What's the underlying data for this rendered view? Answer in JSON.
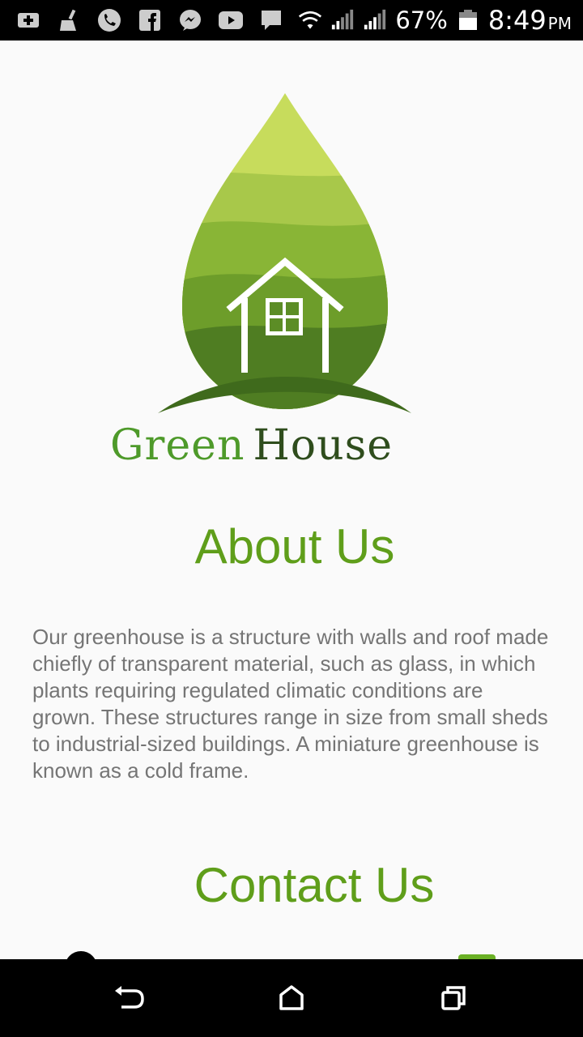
{
  "status_bar": {
    "battery_percent": "67%",
    "time": "8:49",
    "ampm": "PM",
    "icons": [
      "add-box-icon",
      "broom-icon",
      "phone-icon",
      "facebook-icon",
      "messenger-icon",
      "youtube-icon",
      "message-icon",
      "wifi-icon",
      "signal-1-icon",
      "signal-2-icon",
      "battery-icon"
    ]
  },
  "logo": {
    "brand_green": "Green",
    "brand_house": "House"
  },
  "about": {
    "title": "About Us",
    "text": "Our greenhouse is a structure with walls and roof made chiefly of transparent material, such as glass, in which plants requiring regulated climatic conditions are grown. These structures range in size from small sheds to industrial-sized buildings. A miniature greenhouse is known as a cold frame."
  },
  "contact": {
    "title": "Contact Us"
  },
  "nav_bar": {
    "icons": [
      "back-icon",
      "home-icon",
      "recents-icon"
    ]
  },
  "colors": {
    "accent": "#5f9e1a",
    "body_text": "#757575",
    "background": "#fafafa"
  }
}
